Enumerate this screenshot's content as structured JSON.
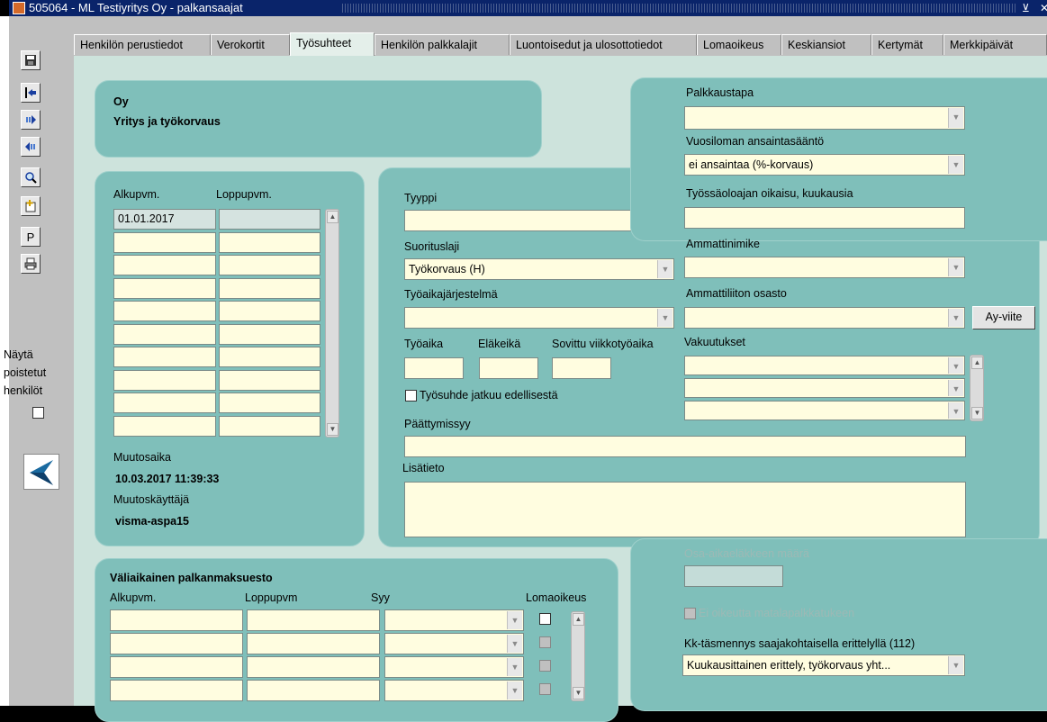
{
  "window": {
    "title": "505064 - ML Testiyritys Oy - palkansaajat",
    "minimize_glyph": "⊻",
    "close_glyph": "✕"
  },
  "toolbar": {
    "icons": [
      "save-icon",
      "exit-icon",
      "next-record-icon",
      "previous-record-icon",
      "search-icon",
      "new-record-icon",
      "p-icon",
      "print-icon"
    ],
    "p_label": "P",
    "show_deleted_line1": "Näytä",
    "show_deleted_line2": "poistetut",
    "show_deleted_line3": "henkilöt"
  },
  "tabs": [
    {
      "label": "Henkilön perustiedot"
    },
    {
      "label": "Verokortit"
    },
    {
      "label": "Työsuhteet"
    },
    {
      "label": "Henkilön palkkalajit"
    },
    {
      "label": "Luontoisedut ja ulosottotiedot"
    },
    {
      "label": "Lomaoikeus"
    },
    {
      "label": "Keskiansiot"
    },
    {
      "label": "Kertymät"
    },
    {
      "label": "Merkkipäivät"
    }
  ],
  "company": {
    "name": "Oy",
    "type": "Yritys ja työkorvaus"
  },
  "employments": {
    "col_start": "Alkupvm.",
    "col_end": "Loppupvm.",
    "rows": [
      {
        "start": "01.01.2017",
        "end": ""
      },
      {
        "start": "",
        "end": ""
      },
      {
        "start": "",
        "end": ""
      },
      {
        "start": "",
        "end": ""
      },
      {
        "start": "",
        "end": ""
      },
      {
        "start": "",
        "end": ""
      },
      {
        "start": "",
        "end": ""
      },
      {
        "start": "",
        "end": ""
      },
      {
        "start": "",
        "end": ""
      },
      {
        "start": "",
        "end": ""
      }
    ],
    "modified_label": "Muutosaika",
    "modified_value": "10.03.2017 11:39:33",
    "modifier_label": "Muutoskäyttäjä",
    "modifier_value": "visma-aspa15"
  },
  "details": {
    "tyyppi_label": "Tyyppi",
    "tyyppi_value": "",
    "suorituslaji_label": "Suorituslaji",
    "suorituslaji_value": "Työkorvaus (H)",
    "tyoaikajarjestelma_label": "Työaikajärjestelmä",
    "tyoaikajarjestelma_value": "",
    "tyoaika_label": "Työaika",
    "elakeika_label": "Eläkeikä",
    "viikkotyoaika_label": "Sovittu viikkotyöaika",
    "continues_label": "Työsuhde jatkuu edellisestä",
    "end_reason_label": "Päättymissyy",
    "extra_label": "Lisätieto",
    "palkkaustapa_label": "Palkkaustapa",
    "palkkaustapa_value": "",
    "vuosiloma_label": "Vuosiloman ansaintasääntö",
    "vuosiloma_value": "ei ansaintaa (%-korvaus)",
    "tyossaolo_label": "Työssäoloajan oikaisu, kuukausia",
    "ammattinimike_label": "Ammattinimike",
    "ammattiliitto_label": "Ammattiliiton osasto",
    "ayviite_button": "Ay-viite",
    "vakuutukset_label": "Vakuutukset"
  },
  "temp_payment": {
    "title": "Väliaikainen palkanmaksuesto",
    "col_start": "Alkupvm.",
    "col_end": "Loppupvm",
    "col_reason": "Syy",
    "col_holiday": "Lomaoikeus"
  },
  "misc": {
    "osa_aika_label": "Osa-aikaeläkkeen määrä",
    "low_wage_label": "Ei oikeutta matalapalkkatukeen",
    "kk_label": "Kk-täsmennys saajakohtaisella erittelyllä (112)",
    "kk_value": "Kuukausittainen erittely, työkorvaus yht..."
  },
  "colors": {
    "panel": "#7fbfba",
    "background": "#cde3dc",
    "field": "#fffde0",
    "titlebar": "#0a246a"
  }
}
